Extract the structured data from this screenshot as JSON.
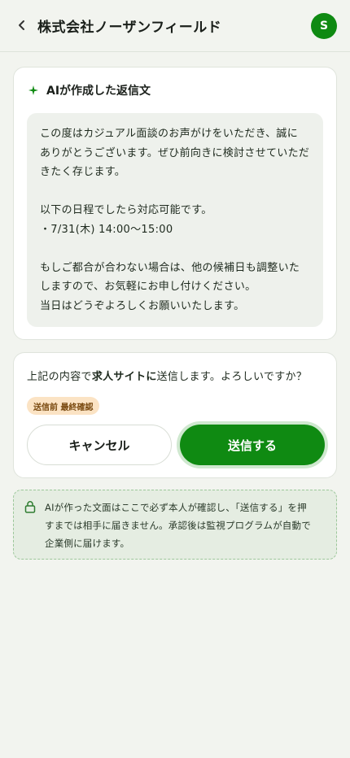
{
  "header": {
    "title": "株式会社ノーザンフィールド",
    "avatar_initial": "S",
    "back_icon": "chevron-left-icon",
    "avatar_color": "#0f8a12"
  },
  "reply_card": {
    "icon": "sparkle-icon",
    "title": "AIが作成した返信文",
    "body_lines": [
      "この度はカジュアル面談のお声がけをいただき、誠に",
      "ありがとうございます。ぜひ前向きに検討させていただ",
      "きたく存じます。",
      "",
      "以下の日程でしたら対応可能です。",
      "・7/31(木) 14:00〜15:00",
      "",
      "もしご都合が合わない場合は、他の候補日も調整いた",
      "しますので、お気軽にお申し付けください。",
      "当日はどうぞよろしくお願いいたします。"
    ]
  },
  "confirm_card": {
    "text_before": "上記の内容で",
    "text_bold": "求人サイトに",
    "text_after": "送信します。よろしいですか？",
    "badge": "送信前 最終確認",
    "cancel_label": "キャンセル",
    "send_label": "送信する",
    "send_color": "#0f8a12",
    "badge_color": "#fbe3c4"
  },
  "notice": {
    "icon": "lock-icon",
    "lines": [
      "AIが作った文面はここで必ず本人が確認し、「送信する」を押",
      "すまでは相手に届きません。承認後は監視プログラムが自動で",
      "企業側に届けます。"
    ]
  }
}
